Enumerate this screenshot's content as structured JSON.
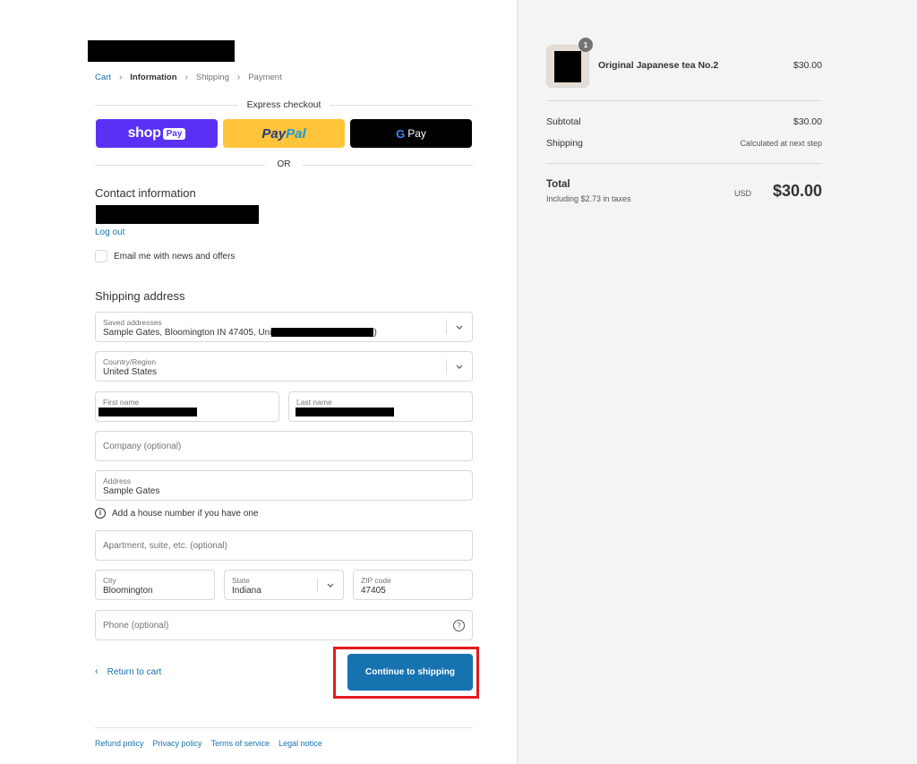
{
  "breadcrumb": [
    "Cart",
    "Information",
    "Shipping",
    "Payment"
  ],
  "express_checkout": {
    "title": "Express checkout",
    "shop_pay": {
      "shop": "shop",
      "pay": "Pay"
    },
    "paypal": {
      "part1": "Pay",
      "part2": "Pal"
    },
    "gpay": {
      "g": "G",
      "pay": "Pay"
    },
    "or_label": "OR"
  },
  "contact": {
    "title": "Contact information",
    "logout": "Log out",
    "newsletter_label": "Email me with news and offers"
  },
  "shipping_address": {
    "title": "Shipping address",
    "saved_addresses": {
      "label": "Saved addresses",
      "value_prefix": "Sample Gates, Bloomington IN 47405, Uni",
      "value_suffix": ")"
    },
    "country": {
      "label": "Country/Region",
      "value": "United States"
    },
    "first_name": {
      "label": "First name"
    },
    "last_name": {
      "label": "Last name"
    },
    "company": {
      "placeholder": "Company (optional)"
    },
    "address": {
      "label": "Address",
      "value": "Sample Gates"
    },
    "address_hint": "Add a house number if you have one",
    "apartment": {
      "placeholder": "Apartment, suite, etc. (optional)"
    },
    "city": {
      "label": "City",
      "value": "Bloomington"
    },
    "state": {
      "label": "State",
      "value": "Indiana"
    },
    "zip": {
      "label": "ZIP code",
      "value": "47405"
    },
    "phone": {
      "placeholder": "Phone (optional)"
    }
  },
  "actions": {
    "return_to_cart": "Return to cart",
    "continue": "Continue to shipping"
  },
  "footer_links": [
    "Refund policy",
    "Privacy policy",
    "Terms of service",
    "Legal notice"
  ],
  "order_summary": {
    "product": {
      "name": "Original Japanese tea No.2",
      "price": "$30.00",
      "quantity": "1"
    },
    "subtotal_label": "Subtotal",
    "subtotal_value": "$30.00",
    "shipping_label": "Shipping",
    "shipping_value": "Calculated at next step",
    "total_label": "Total",
    "taxes_note": "Including $2.73 in taxes",
    "currency": "USD",
    "total_value": "$30.00"
  },
  "colors": {
    "accent": "#1773b0",
    "shop_pay": "#5a31f4",
    "paypal": "#ffc439",
    "highlight": "#e31a1c",
    "summary_bg": "#f4f4f4"
  },
  "icons": {
    "chevron": "chevron-down-icon",
    "info": "info-icon",
    "help": "question-circle-icon",
    "back": "chevron-left-icon"
  }
}
